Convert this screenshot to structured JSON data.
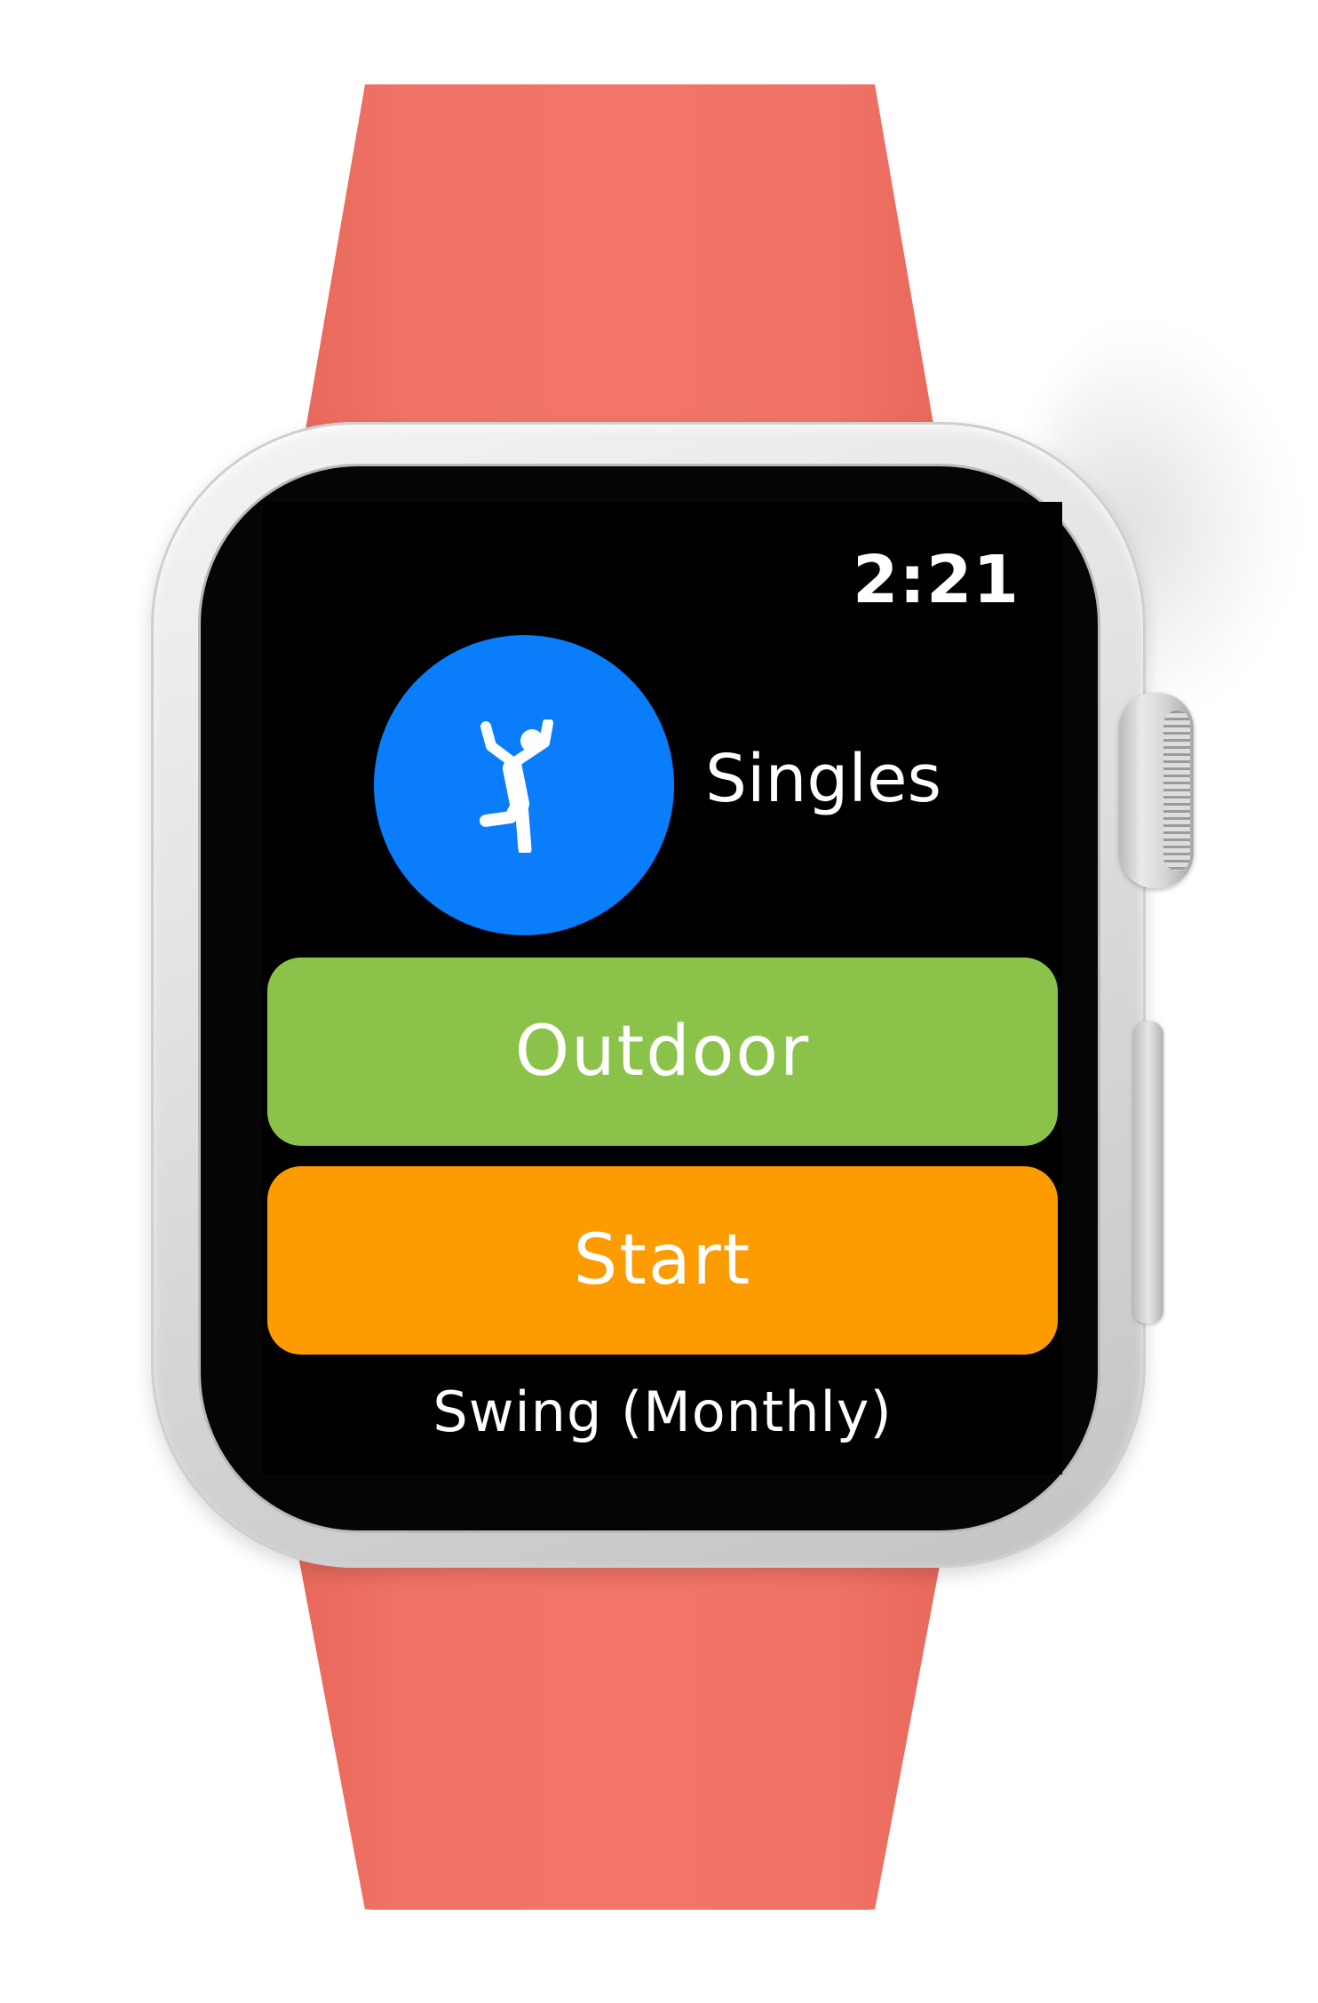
{
  "status_bar": {
    "time": "2:21"
  },
  "activity": {
    "icon": "jumping-person-icon",
    "label": "Singles",
    "color": "#0a7dfa"
  },
  "buttons": {
    "location_label": "Outdoor",
    "location_color": "#8bc34a",
    "start_label": "Start",
    "start_color": "#fd9c00"
  },
  "footer": {
    "subscription_label": "Swing (Monthly)"
  },
  "device": {
    "band_color": "#f27568",
    "case_color": "#e4e4e6"
  }
}
